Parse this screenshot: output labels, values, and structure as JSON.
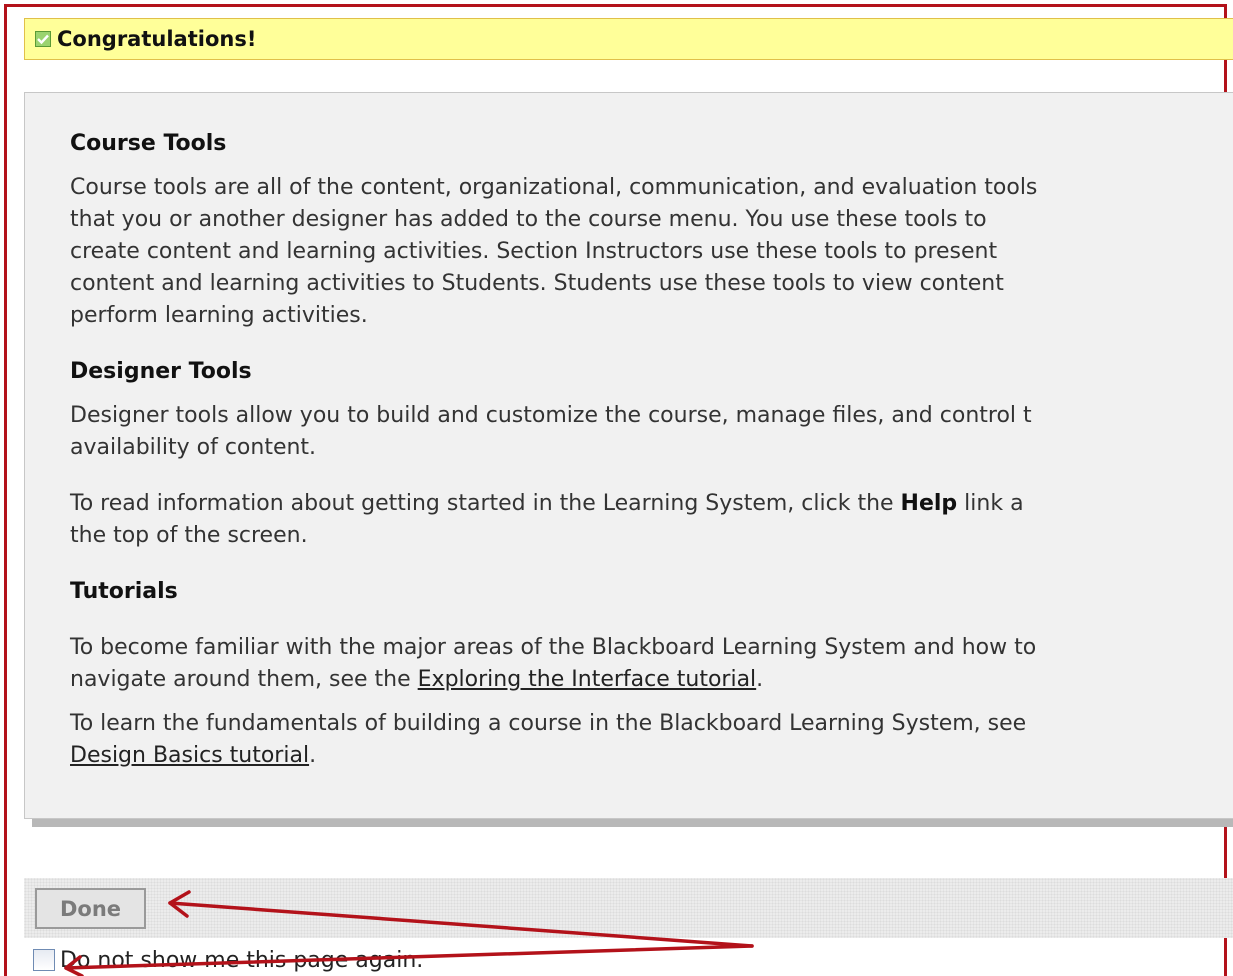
{
  "banner": {
    "title": "Congratulations!"
  },
  "sections": {
    "course_tools": {
      "heading": "Course Tools",
      "lines": [
        "Course tools are all of the content, organizational, communication, and evaluation tools",
        "that you or another designer has added to the course menu. You use these tools to",
        "create content and learning activities. Section Instructors use these tools to present",
        "content and learning activities to Students. Students use these tools to view content",
        "perform learning activities."
      ]
    },
    "designer_tools": {
      "heading": "Designer Tools",
      "lines": [
        "Designer tools allow you to build and customize the course, manage files, and control t",
        "availability of content."
      ],
      "help_text_before": "To read information about getting started in the Learning System, click the ",
      "help_bold": "Help",
      "help_text_after": " link a",
      "help_line2": "the top of the screen."
    },
    "tutorials": {
      "heading": "Tutorials",
      "p1_line1": "To become familiar with the major areas of the Blackboard Learning System and how to",
      "p1_line2_before": "navigate around them, see the ",
      "p1_link": "Exploring the Interface tutorial",
      "p1_line2_after": ".",
      "p2_line1": "To learn the fundamentals of building a course in the Blackboard Learning System, see",
      "p2_link": "Design Basics tutorial",
      "p2_line2_after": "."
    }
  },
  "footer": {
    "done_label": "Done",
    "checkbox_label": "Do not show me this page again."
  },
  "colors": {
    "frame": "#b3121a",
    "banner_bg": "#ffff99",
    "panel_bg": "#f1f1f1",
    "annotation_arrow": "#b3121a"
  }
}
